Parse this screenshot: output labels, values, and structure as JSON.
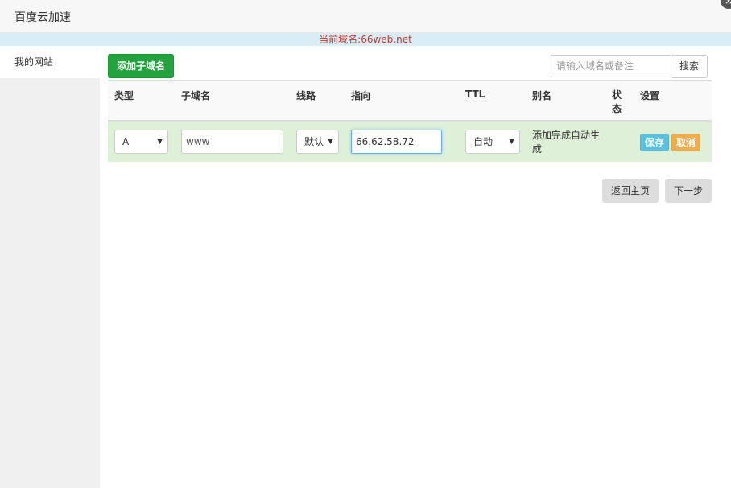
{
  "header": {
    "title": "百度云加速",
    "close_icon": "×"
  },
  "domain_bar": {
    "text": "当前域名:66web.net",
    "color": "#c0392b"
  },
  "sidebar": {
    "items": [
      {
        "label": "我的网站"
      }
    ]
  },
  "toolbar": {
    "add_label": "添加子域名",
    "search_placeholder": "请输入域名或备注",
    "search_label": "搜索"
  },
  "table": {
    "headers": {
      "type": "类型",
      "subdomain": "子域名",
      "line": "线路",
      "target": "指向",
      "ttl": "TTL",
      "alias": "别名",
      "status": "状态",
      "settings": "设置"
    },
    "row": {
      "type": "A",
      "subdomain": "www",
      "line": "默认",
      "target": "66.62.58.72",
      "ttl": "自动",
      "alias": "添加完成自动生成",
      "save_label": "保存",
      "cancel_label": "取消"
    }
  },
  "footer": {
    "back_label": "返回主页",
    "next_label": "下一步"
  },
  "colors": {
    "add_button": "#22a33d",
    "row_bg": "#dff0d8",
    "save": "#5bc0de",
    "cancel": "#f0ad4e",
    "domain_bar_bg": "#d9edf7"
  }
}
